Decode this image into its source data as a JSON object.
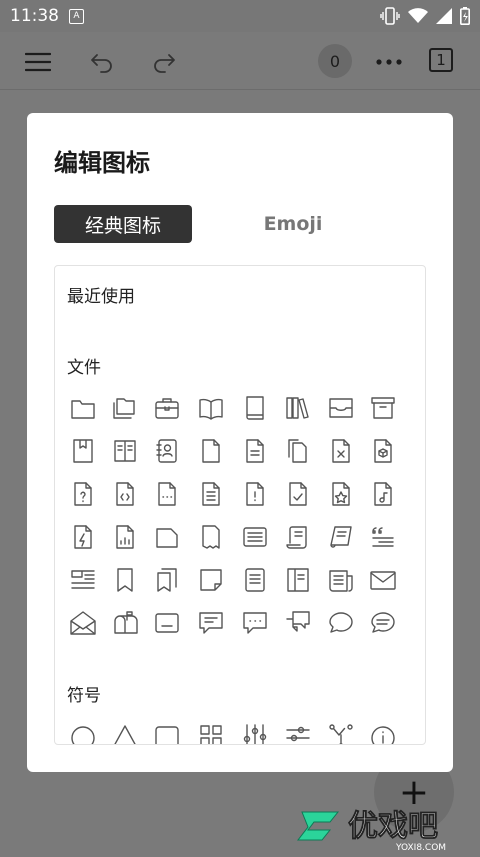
{
  "status_bar": {
    "time": "11:38",
    "notification_glyph": "A",
    "icons": [
      "vibrate-icon",
      "wifi-icon",
      "signal-icon",
      "battery-icon"
    ]
  },
  "toolbar": {
    "icons": [
      "menu-icon",
      "undo-icon",
      "redo-icon",
      "more-icon"
    ],
    "counter": "0",
    "pages": "1"
  },
  "dialog": {
    "title": "编辑图标",
    "tabs": [
      {
        "label": "经典图标",
        "active": true
      },
      {
        "label": "Emoji",
        "active": false
      }
    ],
    "sections": [
      {
        "label": "最近使用"
      },
      {
        "label": "文件"
      },
      {
        "label": "符号"
      }
    ],
    "file_icons": [
      "folder-icon",
      "folders-icon",
      "briefcase-icon",
      "open-book-icon",
      "book-icon",
      "books-icon",
      "tray-icon",
      "archive-icon",
      "bookmark-book-icon",
      "notebook-icon",
      "contact-book-icon",
      "file-icon",
      "file-text-icon",
      "files-icon",
      "file-x-icon",
      "file-box-icon",
      "file-question-icon",
      "file-code-icon",
      "file-dots-icon",
      "file-list-icon",
      "file-alert-icon",
      "file-check-icon",
      "file-star-icon",
      "file-music-icon",
      "file-bolt-icon",
      "file-chart-icon",
      "file-folded-icon",
      "file-torn-icon",
      "document-lines-icon",
      "scroll-icon",
      "scroll-open-icon",
      "quote-icon",
      "layout-icon",
      "bookmark-icon",
      "bookmarks-icon",
      "sticky-note-icon",
      "note-list-icon",
      "book-split-icon",
      "newspaper-icon",
      "mail-icon",
      "mail-open-icon",
      "mailbox-icon",
      "inbox-icon",
      "chat-text-icon",
      "chat-dots-icon",
      "chats-icon",
      "chat-round-icon",
      "chat-round-text-icon"
    ],
    "symbol_icons": [
      "circle-icon",
      "triangle-icon",
      "square-icon",
      "grid-icon",
      "sliders-vertical-icon",
      "sliders-horizontal-icon",
      "network-icon",
      "info-icon"
    ]
  },
  "fab": {
    "label": "+"
  },
  "watermark": {
    "brand": "优戏吧",
    "url": "YOXI8.COM"
  }
}
